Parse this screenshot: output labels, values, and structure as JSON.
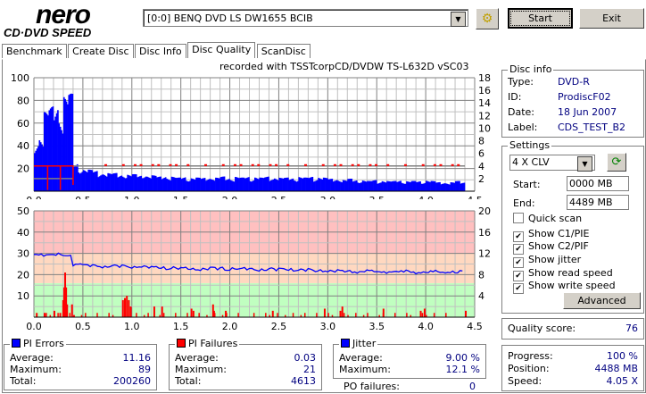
{
  "app": {
    "logo_top": "nero",
    "logo_bottom": "CD·DVD SPEED"
  },
  "toolbar": {
    "drive": "[0:0]  BENQ DVD LS DW1655 BCIB",
    "start_label": "Start",
    "exit_label": "Exit"
  },
  "tabs": [
    {
      "label": "Benchmark"
    },
    {
      "label": "Create Disc"
    },
    {
      "label": "Disc Info"
    },
    {
      "label": "Disc Quality",
      "active": true
    },
    {
      "label": "ScanDisc"
    }
  ],
  "recorded_with": "recorded with TSSTcorpCD/DVDW TS-L632D vSC03",
  "disc_info": {
    "title": "Disc info",
    "type_label": "Type:",
    "type": "DVD-R",
    "id_label": "ID:",
    "id": "ProdiscF02",
    "date_label": "Date:",
    "date": "18 Jun 2007",
    "label_label": "Label:",
    "label": "CDS_TEST_B2"
  },
  "settings": {
    "title": "Settings",
    "speed": "4 X CLV",
    "start_label": "Start:",
    "start": "0000 MB",
    "end_label": "End:",
    "end": "4489 MB",
    "checks": [
      {
        "label": "Quick scan",
        "checked": false
      },
      {
        "label": "Show C1/PIE",
        "checked": true
      },
      {
        "label": "Show C2/PIF",
        "checked": true
      },
      {
        "label": "Show jitter",
        "checked": true
      },
      {
        "label": "Show read speed",
        "checked": true
      },
      {
        "label": "Show write speed",
        "checked": true
      }
    ],
    "advanced_label": "Advanced"
  },
  "quality": {
    "label": "Quality score:",
    "value": "76"
  },
  "progress": {
    "progress_label": "Progress:",
    "progress": "100 %",
    "position_label": "Position:",
    "position": "4488 MB",
    "speed_label": "Speed:",
    "speed": "4.05 X"
  },
  "pi_errors": {
    "title": "PI Errors",
    "avg_label": "Average:",
    "avg": "11.16",
    "max_label": "Maximum:",
    "max": "89",
    "total_label": "Total:",
    "total": "200260",
    "color": "#0000ff"
  },
  "pi_failures": {
    "title": "PI Failures",
    "avg_label": "Average:",
    "avg": "0.03",
    "max_label": "Maximum:",
    "max": "21",
    "total_label": "Total:",
    "total": "4613",
    "color": "#ff0000"
  },
  "jitter": {
    "title": "Jitter",
    "avg_label": "Average:",
    "avg": "9.00 %",
    "max_label": "Maximum:",
    "max": "12.1 %",
    "po_label": "PO failures:",
    "po": "0",
    "color": "#0000ff"
  },
  "chart_data": [
    {
      "type": "bar",
      "title": "PI Errors / Read speed",
      "xlim": [
        0,
        4.5
      ],
      "ylim": [
        0,
        100
      ],
      "y2lim": [
        0,
        18
      ],
      "xticks": [
        "0.0",
        "0.5",
        "1.0",
        "1.5",
        "2.0",
        "2.5",
        "3.0",
        "3.5",
        "4.0",
        "4.5"
      ],
      "yticks": [
        "20",
        "40",
        "60",
        "80",
        "100"
      ],
      "y2ticks": [
        "2",
        "4",
        "6",
        "8",
        "10",
        "12",
        "14",
        "16",
        "18"
      ],
      "step": 0.05,
      "pi_errors": [
        48,
        50,
        70,
        75,
        80,
        72,
        85,
        86,
        25,
        22,
        20,
        19,
        18,
        17,
        17,
        16,
        16,
        15,
        16,
        15,
        15,
        14,
        16,
        14,
        14,
        13,
        14,
        13,
        13,
        12,
        13,
        12,
        12,
        12,
        12,
        13,
        12,
        12,
        13,
        12,
        12,
        13,
        12,
        13,
        12,
        13,
        12,
        13,
        12,
        13,
        12,
        12,
        12,
        12,
        13,
        12,
        13,
        12,
        13,
        12,
        11,
        11,
        11,
        10,
        11,
        10,
        10,
        10,
        9,
        10,
        9,
        10,
        9,
        9,
        10,
        9,
        9,
        9,
        9,
        9,
        10,
        9,
        8,
        8,
        8,
        8,
        9,
        8
      ],
      "read_speed": 4.0
    },
    {
      "type": "bar",
      "title": "PI Failures / Jitter",
      "xlim": [
        0,
        4.5
      ],
      "ylim": [
        0,
        50
      ],
      "y2lim": [
        0,
        20
      ],
      "xticks": [
        "0.0",
        "0.5",
        "1.0",
        "1.5",
        "2.0",
        "2.5",
        "3.0",
        "3.5",
        "4.0",
        "4.5"
      ],
      "yticks": [
        "10",
        "20",
        "30",
        "40",
        "50"
      ],
      "y2ticks": [
        "4",
        "8",
        "12",
        "16",
        "20"
      ],
      "pi_failures": [
        [
          0.02,
          2
        ],
        [
          0.1,
          2
        ],
        [
          0.2,
          3
        ],
        [
          0.26,
          2
        ],
        [
          0.29,
          8
        ],
        [
          0.3,
          14
        ],
        [
          0.31,
          21
        ],
        [
          0.32,
          14
        ],
        [
          0.33,
          6
        ],
        [
          0.38,
          6
        ],
        [
          0.4,
          1
        ],
        [
          0.9,
          8
        ],
        [
          0.92,
          9
        ],
        [
          0.94,
          10
        ],
        [
          0.96,
          8
        ],
        [
          0.98,
          5
        ],
        [
          1.22,
          5
        ],
        [
          1.3,
          5
        ],
        [
          1.6,
          4
        ],
        [
          1.62,
          3
        ],
        [
          1.82,
          6
        ],
        [
          1.83,
          3
        ],
        [
          1.95,
          3
        ],
        [
          2.43,
          3
        ],
        [
          2.96,
          4
        ],
        [
          3.12,
          3
        ],
        [
          3.14,
          5
        ],
        [
          3.56,
          4
        ],
        [
          3.94,
          3
        ],
        [
          3.98,
          4
        ],
        [
          4.4,
          3
        ]
      ],
      "jitter": [
        11.8,
        11.9,
        11.7,
        11.8,
        11.6,
        11.8,
        11.5,
        11.7,
        9.9,
        10.1,
        9.8,
        9.6,
        9.7,
        9.6,
        9.5,
        9.6,
        9.7,
        9.5,
        9.6,
        9.5,
        9.4,
        9.6,
        9.5,
        9.4,
        9.3,
        9.4,
        9.3,
        9.2,
        9.3,
        9.2,
        9.1,
        9.2,
        9.0,
        9.1,
        9.0,
        9.1,
        9.2,
        9.1,
        9.2,
        9.0,
        9.1,
        9.2,
        9.0,
        9.1,
        9.0,
        9.0,
        8.9,
        9.0,
        9.1,
        8.9,
        9.0,
        9.1,
        9.0,
        8.9,
        8.9,
        8.8,
        8.9,
        8.7,
        8.8,
        8.8,
        8.7,
        8.6,
        8.7,
        8.6,
        8.7,
        8.6,
        8.5,
        8.6,
        8.7,
        8.6,
        8.5,
        8.6,
        8.5,
        8.6,
        8.5,
        8.5,
        8.7,
        8.5,
        8.4,
        8.5,
        8.4,
        8.5,
        8.6,
        8.4,
        8.5,
        8.6,
        8.4,
        8.6
      ],
      "step": 0.05,
      "bands": [
        {
          "from": 0,
          "to": 16,
          "color": "#c0ffc0"
        },
        {
          "from": 16,
          "to": 30,
          "color": "#ffd8c0"
        },
        {
          "from": 30,
          "to": 50,
          "color": "#ffc0c0"
        }
      ]
    }
  ]
}
